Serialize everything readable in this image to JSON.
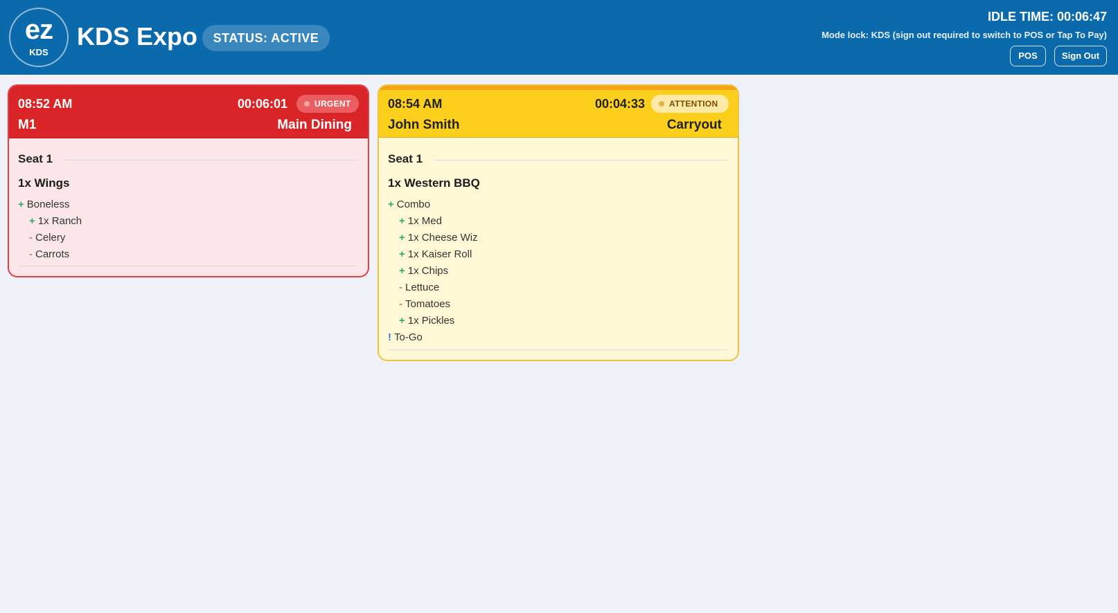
{
  "header": {
    "logo_text": "ez",
    "logo_sub": "KDS",
    "title": "KDS Expo",
    "status": "STATUS: ACTIVE",
    "idle_time": "IDLE TIME: 00:06:47",
    "mode_lock": "Mode lock: KDS (sign out required to switch to POS or Tap To Pay)",
    "pos_button": "POS",
    "signout_button": "Sign Out"
  },
  "tickets": [
    {
      "time": "08:52 AM",
      "elapsed": "00:06:01",
      "badge": "URGENT",
      "order": "M1",
      "order_type": "Main Dining",
      "seat": "Seat 1",
      "item": "1x Wings",
      "mods": [
        {
          "sym": "+",
          "text": "Boneless"
        },
        {
          "sym": "+",
          "text": "1x Ranch"
        },
        {
          "sym": "-",
          "text": "Celery"
        },
        {
          "sym": "-",
          "text": "Carrots"
        }
      ],
      "accent": "#d92528"
    },
    {
      "time": "08:54 AM",
      "elapsed": "00:04:33",
      "badge": "ATTENTION",
      "order": "John Smith",
      "order_type": "Carryout",
      "seat": "Seat 1",
      "item": "1x Western BBQ",
      "mods": [
        {
          "sym": "+",
          "text": "Combo"
        },
        {
          "sym": "+",
          "text": "1x Med"
        },
        {
          "sym": "+",
          "text": "1x Cheese Wiz"
        },
        {
          "sym": "+",
          "text": "1x Kaiser Roll"
        },
        {
          "sym": "+",
          "text": "1x Chips"
        },
        {
          "sym": "-",
          "text": "Lettuce"
        },
        {
          "sym": "-",
          "text": "Tomatoes"
        },
        {
          "sym": "+",
          "text": "1x Pickles"
        },
        {
          "sym": "!",
          "text": "To-Go"
        }
      ],
      "accent": "#fbcf1c"
    }
  ],
  "colors": {
    "header_bg": "#0b6aab",
    "page_bg": "#f0f1f9",
    "urgent": "#d92528",
    "attention": "#fbcf1c",
    "mod_add": "#2eaa6a",
    "mod_remove": "#c0392b",
    "mod_note": "#2f7bd8"
  }
}
